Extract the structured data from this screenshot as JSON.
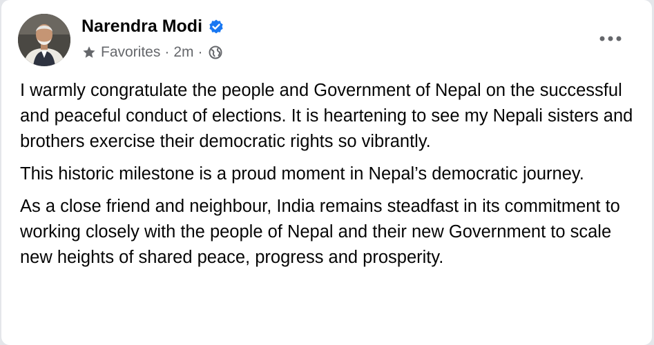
{
  "post": {
    "author_name": "Narendra Modi",
    "audience_label": "Favorites",
    "separator": "·",
    "time_ago": "2m",
    "icons": {
      "verified": "verified-badge-icon",
      "audience": "star-icon",
      "privacy": "globe-icon",
      "more": "more-options-icon"
    },
    "colors": {
      "verified": "#1877f2",
      "meta_text": "#65676b",
      "body_text": "#050505"
    },
    "paragraphs": [
      "I warmly congratulate the people and Government of Nepal on the successful and peaceful conduct of elections. It is heartening to see my Nepali sisters and brothers exercise their democratic rights so vibrantly.",
      "This historic milestone is a proud moment in Nepal’s democratic journey.",
      "As a close friend and neighbour, India remains steadfast in its commitment to working closely with the people of Nepal and their new Government to scale new heights of shared peace, progress and prosperity."
    ]
  }
}
